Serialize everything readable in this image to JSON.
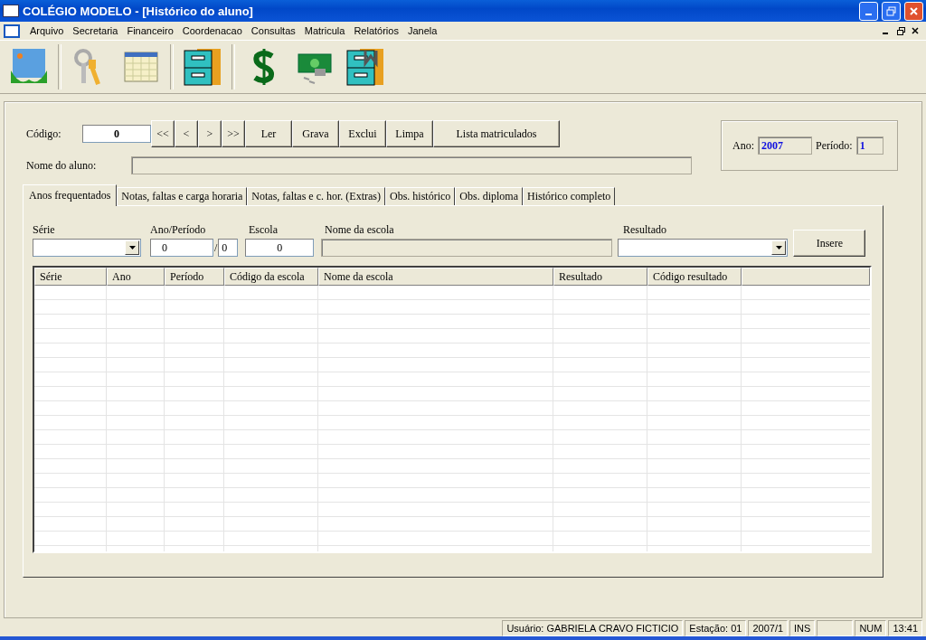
{
  "window": {
    "title": "COLÉGIO MODELO - [Histórico do aluno]"
  },
  "menu": [
    "Arquivo",
    "Secretaria",
    "Financeiro",
    "Coordenacao",
    "Consultas",
    "Matricula",
    "Relatórios",
    "Janela"
  ],
  "form": {
    "codigo_label": "Código:",
    "codigo_value": "0",
    "nav_buttons": [
      "<<",
      "<",
      ">",
      ">>",
      "Ler",
      "Grava",
      "Exclui",
      "Limpa",
      "Lista matriculados"
    ],
    "nome_label": "Nome do aluno:",
    "ano_label": "Ano:",
    "ano_value": "2007",
    "periodo_label": "Período:",
    "periodo_value": "1"
  },
  "tabs": [
    {
      "label": "Anos frequentados",
      "selected": true
    },
    {
      "label": "Notas, faltas e carga horaria",
      "selected": false
    },
    {
      "label": "Notas, faltas e c. hor. (Extras)",
      "selected": false
    },
    {
      "label": "Obs. histórico",
      "selected": false
    },
    {
      "label": "Obs. diploma",
      "selected": false
    },
    {
      "label": "Histórico completo",
      "selected": false
    }
  ],
  "entry": {
    "serie_label": "Série",
    "ano_periodo_label": "Ano/Período",
    "ano_value": "0",
    "separator": "/",
    "periodo_value": "0",
    "escola_label": "Escola",
    "escola_value": "0",
    "nome_escola_label": "Nome da escola",
    "resultado_label": "Resultado",
    "insert_button": "Insere"
  },
  "table": {
    "columns": [
      "Série",
      "Ano",
      "Período",
      "Código da escola",
      "Nome da escola",
      "Resultado",
      "Código resultado"
    ]
  },
  "status_bar": [
    "Usuário: GABRIELA CRAVO FICTICIO",
    "Estação: 01",
    "2007/1",
    "INS",
    "NUM",
    "13:41"
  ]
}
